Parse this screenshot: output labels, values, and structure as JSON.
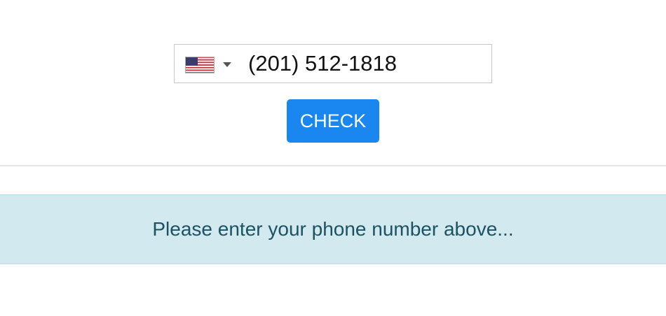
{
  "phone_form": {
    "country": {
      "code": "US",
      "flag_icon": "us-flag-icon",
      "dropdown_icon": "caret-down-icon"
    },
    "phone_value": "(201) 512-1818",
    "check_label": "CHECK"
  },
  "alert": {
    "message": "Please enter your phone number above..."
  },
  "colors": {
    "button": "#1a86ef",
    "alert_bg": "#d2e9ef",
    "alert_text": "#1c5262"
  }
}
